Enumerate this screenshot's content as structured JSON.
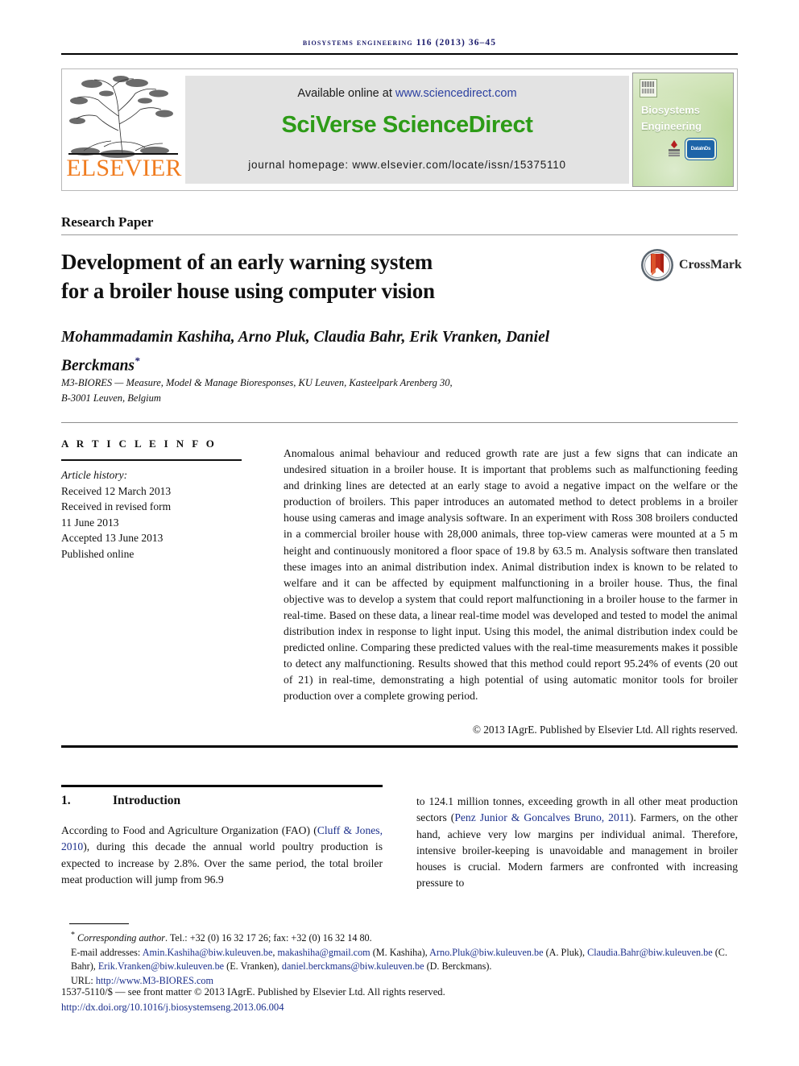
{
  "running_head": "Biosystems Engineering 116 (2013) 36–45",
  "masthead": {
    "publisher_name": "ELSEVIER",
    "available_prefix": "Available online at ",
    "available_link": "www.sciencedirect.com",
    "platform_title": "SciVerse ScienceDirect",
    "homepage": "journal homepage: www.elsevier.com/locate/issn/15375110",
    "cover_title_line1": "Biosystems",
    "cover_title_line2": "Engineering",
    "cover_badge_iagre": "IAgrE",
    "cover_badge_datain": "DataInDs",
    "colors": {
      "elsevier_orange": "#f07c1f",
      "sciencedirect_green": "#2d9b17",
      "link_blue": "#2b3fa0",
      "banner_grey": "#e3e3e3",
      "cover_green": "#b8d697"
    }
  },
  "article": {
    "type": "Research Paper",
    "title_line1": "Development of an early warning system",
    "title_line2": "for a broiler house using computer vision",
    "crossmark_label": "CrossMark",
    "authors": "Mohammadamin Kashiha, Arno Pluk, Claudia Bahr, Erik Vranken, Daniel Berckmans",
    "author_marker": "*",
    "affiliation_line1": "M3-BIORES — Measure, Model & Manage Bioresponses, KU Leuven, Kasteelpark Arenberg 30,",
    "affiliation_line2": "B-3001 Leuven, Belgium"
  },
  "article_info": {
    "heading": "A R T I C L E   I N F O",
    "history_label": "Article history:",
    "received": "Received 12 March 2013",
    "revised_label": "Received in revised form",
    "revised_date": "11 June 2013",
    "accepted": "Accepted 13 June 2013",
    "published": "Published online"
  },
  "abstract": {
    "text": "Anomalous animal behaviour and reduced growth rate are just a few signs that can indicate an undesired situation in a broiler house. It is important that problems such as malfunctioning feeding and drinking lines are detected at an early stage to avoid a negative impact on the welfare or the production of broilers. This paper introduces an automated method to detect problems in a broiler house using cameras and image analysis software. In an experiment with Ross 308 broilers conducted in a commercial broiler house with 28,000 animals, three top-view cameras were mounted at a 5 m height and continuously monitored a floor space of 19.8 by 63.5 m. Analysis software then translated these images into an animal distribution index. Animal distribution index is known to be related to welfare and it can be affected by equipment malfunctioning in a broiler house. Thus, the final objective was to develop a system that could report malfunctioning in a broiler house to the farmer in real-time. Based on these data, a linear real-time model was developed and tested to model the animal distribution index in response to light input. Using this model, the animal distribution index could be predicted online. Comparing these predicted values with the real-time measurements makes it possible to detect any malfunctioning. Results showed that this method could report 95.24% of events (20 out of 21) in real-time, demonstrating a high potential of using automatic monitor tools for broiler production over a complete growing period.",
    "copyright": "© 2013 IAgrE. Published by Elsevier Ltd. All rights reserved."
  },
  "section": {
    "number": "1.",
    "title": "Introduction",
    "left_text_a": "According to Food and Agriculture Organization (FAO) (",
    "left_ref_1": "Cluff & Jones, 2010",
    "left_text_b": "), during this decade the annual world poultry production is expected to increase by 2.8%. Over the same period, the total broiler meat production will jump from 96.9",
    "right_text_a": "to 124.1 million tonnes, exceeding growth in all other meat production sectors (",
    "right_ref_1": "Penz Junior & Goncalves Bruno, 2011",
    "right_text_b": "). Farmers, on the other hand, achieve very low margins per individual animal. Therefore, intensive broiler-keeping is unavoidable and management in broiler houses is crucial. Modern farmers are confronted with increasing pressure to"
  },
  "footnotes": {
    "corresponding_label": "Corresponding author",
    "corresponding_rest": ". Tel.: +32 (0) 16 32 17 26; fax: +32 (0) 16 32 14 80.",
    "email_label": "E-mail addresses:",
    "email_1": "Amin.Kashiha@biw.kuleuven.be",
    "email_2": "makashiha@gmail.com",
    "email_1_owner": "(M. Kashiha),",
    "email_3": "Arno.Pluk@biw.kuleuven.be",
    "email_3_owner": "(A. Pluk),",
    "email_4": "Claudia.Bahr@biw.kuleuven.be",
    "email_4_owner": "(C. Bahr),",
    "email_5": "Erik.Vranken@biw.kuleuven.be",
    "email_5_owner": "(E. Vranken),",
    "email_6": "daniel.berckmans@biw.kuleuven.be",
    "email_6_owner": "(D. Berckmans).",
    "url_label": "URL:",
    "url_value": "http://www.M3-BIORES.com",
    "issn_line": "1537-5110/$ — see front matter © 2013 IAgrE. Published by Elsevier Ltd. All rights reserved.",
    "doi_line": "http://dx.doi.org/10.1016/j.biosystemseng.2013.06.004"
  }
}
